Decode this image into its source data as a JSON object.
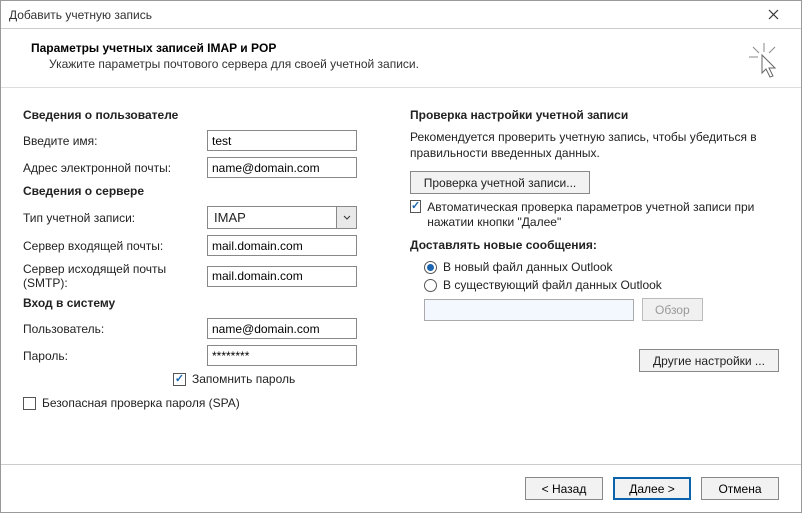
{
  "window": {
    "title": "Добавить учетную запись"
  },
  "header": {
    "title": "Параметры учетных записей IMAP и POP",
    "subtitle": "Укажите параметры почтового сервера для своей учетной записи."
  },
  "left": {
    "userSection": "Сведения о пользователе",
    "nameLabel": "Введите имя:",
    "nameValue": "test",
    "emailLabel": "Адрес электронной почты:",
    "emailValue": "name@domain.com",
    "serverSection": "Сведения о сервере",
    "accountTypeLabel": "Тип учетной записи:",
    "accountTypeValue": "IMAP",
    "incomingLabel": "Сервер входящей почты:",
    "incomingValue": "mail.domain.com",
    "outgoingLabel": "Сервер исходящей почты (SMTP):",
    "outgoingValue": "mail.domain.com",
    "loginSection": "Вход в систему",
    "usernameLabel": "Пользователь:",
    "usernameValue": "name@domain.com",
    "passwordLabel": "Пароль:",
    "passwordValue": "********",
    "rememberLabel": "Запомнить пароль",
    "spaLabel": "Безопасная проверка пароля (SPA)"
  },
  "right": {
    "testSection": "Проверка настройки учетной записи",
    "testDesc": "Рекомендуется проверить учетную запись, чтобы убедиться в правильности введенных данных.",
    "testBtn": "Проверка учетной записи...",
    "autoTestLabel": "Автоматическая проверка параметров учетной записи при нажатии кнопки \"Далее\"",
    "deliverSection": "Доставлять новые сообщения:",
    "deliverNew": "В новый файл данных Outlook",
    "deliverExisting": "В существующий файл данных Outlook",
    "browseBtn": "Обзор",
    "otherBtn": "Другие настройки ..."
  },
  "footer": {
    "back": "< Назад",
    "next": "Далее >",
    "cancel": "Отмена"
  }
}
